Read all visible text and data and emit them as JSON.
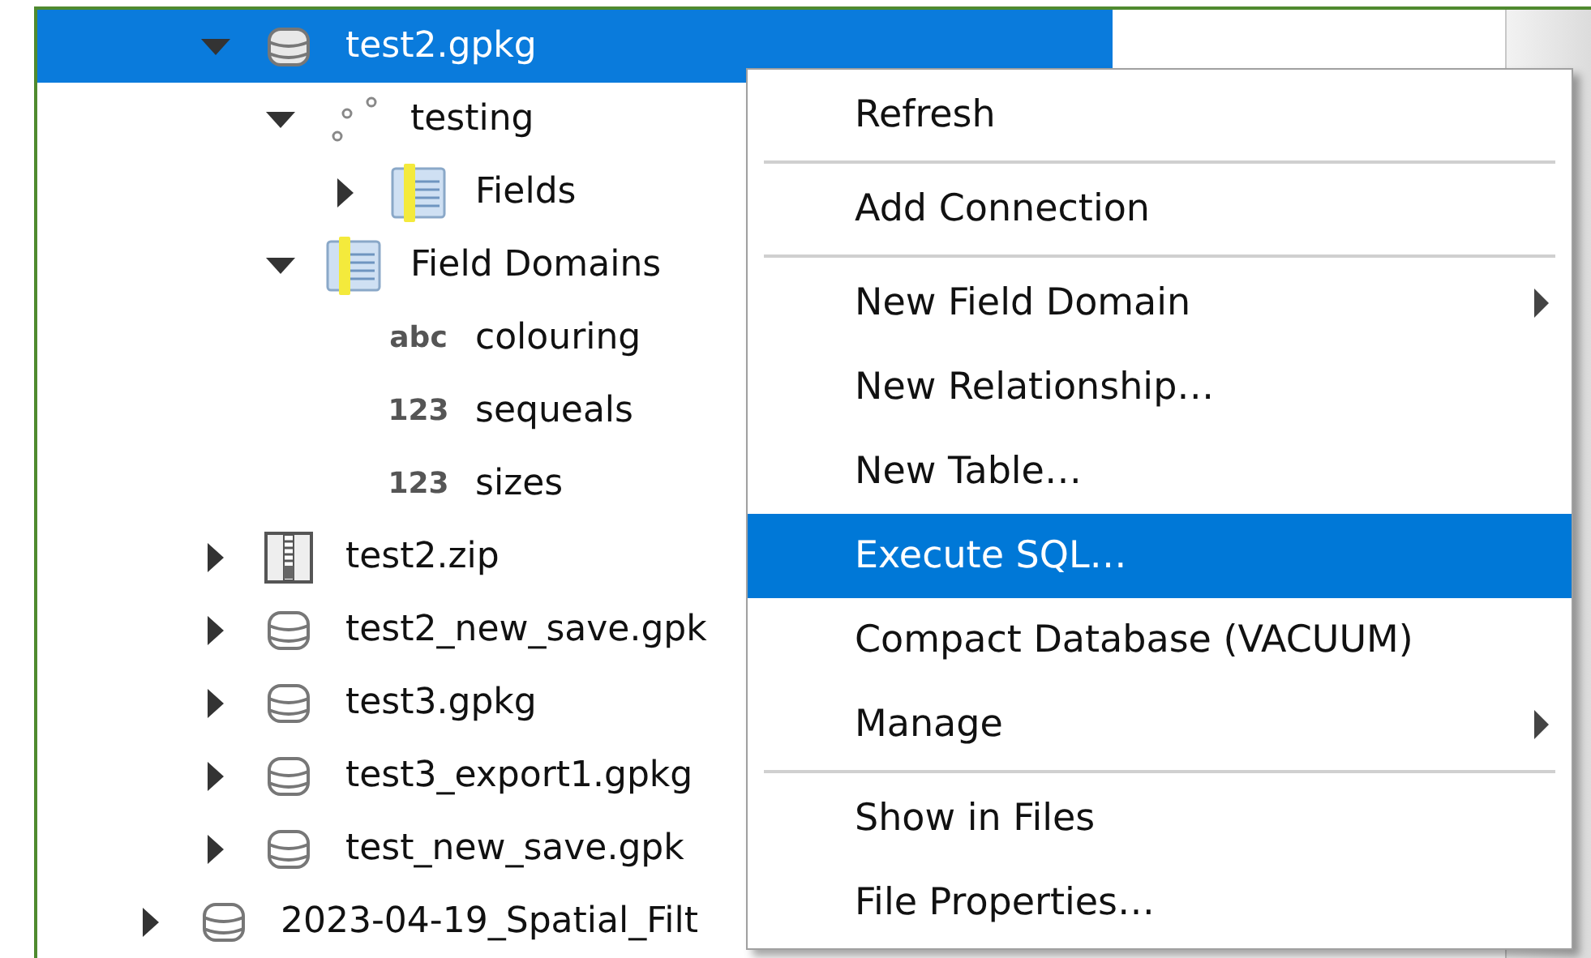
{
  "tree": {
    "items": [
      {
        "kind": "scrolled_parent",
        "children": [
          {
            "kind": "database",
            "label": "test2.gpkg",
            "selected": true,
            "expanded": true,
            "children": [
              {
                "kind": "point_layer",
                "label": "testing",
                "selected": false,
                "expanded": true,
                "children": [
                  {
                    "kind": "table",
                    "label": "Fields",
                    "selected": false,
                    "expanded": false
                  }
                ]
              },
              {
                "kind": "table",
                "label": "Field Domains",
                "selected": false,
                "expanded": true,
                "children": [
                  {
                    "kind": "domain",
                    "type_label": "abc",
                    "label": "colouring",
                    "selected": false
                  },
                  {
                    "kind": "domain",
                    "type_label": "123",
                    "label": "sequeals",
                    "selected": false
                  },
                  {
                    "kind": "domain",
                    "type_label": "123",
                    "label": "sizes",
                    "selected": false
                  }
                ]
              }
            ]
          },
          {
            "kind": "zip",
            "label": "test2.zip",
            "selected": false,
            "expanded": false
          },
          {
            "kind": "database",
            "label": "test2_new_save.gpk",
            "selected": false,
            "expanded": false
          },
          {
            "kind": "database",
            "label": "test3.gpkg",
            "selected": false,
            "expanded": false
          },
          {
            "kind": "database",
            "label": "test3_export1.gpkg",
            "selected": false,
            "expanded": false
          },
          {
            "kind": "database",
            "label": "test_new_save.gpk",
            "selected": false,
            "expanded": false
          }
        ]
      },
      {
        "kind": "database",
        "label": "2023-04-19_Spatial_Filt",
        "selected": false,
        "expanded": false
      }
    ]
  },
  "context_menu": {
    "items": [
      {
        "kind": "item",
        "label": "Refresh",
        "selected": false,
        "submenu": false
      },
      {
        "kind": "separator"
      },
      {
        "kind": "item",
        "label": "Add Connection",
        "selected": false,
        "submenu": false
      },
      {
        "kind": "separator"
      },
      {
        "kind": "item",
        "label": "New Field Domain",
        "selected": false,
        "submenu": true
      },
      {
        "kind": "item",
        "label": "New Relationship…",
        "selected": false,
        "submenu": false
      },
      {
        "kind": "item",
        "label": "New Table…",
        "selected": false,
        "submenu": false
      },
      {
        "kind": "item",
        "label": "Execute SQL…",
        "selected": true,
        "submenu": false
      },
      {
        "kind": "item",
        "label": "Compact Database (VACUUM)",
        "selected": false,
        "submenu": false
      },
      {
        "kind": "item",
        "label": "Manage",
        "selected": false,
        "submenu": true
      },
      {
        "kind": "separator"
      },
      {
        "kind": "item",
        "label": "Show in Files",
        "selected": false,
        "submenu": false
      },
      {
        "kind": "item",
        "label": "File Properties…",
        "selected": false,
        "submenu": false
      }
    ]
  }
}
